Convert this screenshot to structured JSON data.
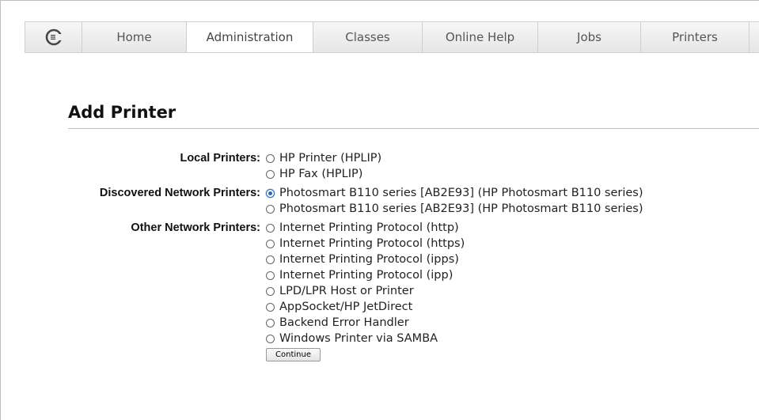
{
  "nav": {
    "tabs": [
      "Home",
      "Administration",
      "Classes",
      "Online Help",
      "Jobs",
      "Printers"
    ],
    "active": "Administration"
  },
  "page": {
    "title": "Add Printer"
  },
  "groups": [
    {
      "label": "Local Printers:",
      "options": [
        "HP Printer (HPLIP)",
        "HP Fax (HPLIP)"
      ]
    },
    {
      "label": "Discovered Network Printers:",
      "options": [
        "Photosmart B110 series [AB2E93] (HP Photosmart B110 series)",
        "Photosmart B110 series [AB2E93] (HP Photosmart B110 series)"
      ]
    },
    {
      "label": "Other Network Printers:",
      "options": [
        "Internet Printing Protocol (http)",
        "Internet Printing Protocol (https)",
        "Internet Printing Protocol (ipps)",
        "Internet Printing Protocol (ipp)",
        "LPD/LPR Host or Printer",
        "AppSocket/HP JetDirect",
        "Backend Error Handler",
        "Windows Printer via SAMBA"
      ]
    }
  ],
  "continue_label": "Continue",
  "icons": {
    "logo": "cups-logo-icon",
    "radio": "radio-icon"
  },
  "colors": {
    "accent": "#2b6cb0",
    "nav_bg": "#eeeeee"
  }
}
